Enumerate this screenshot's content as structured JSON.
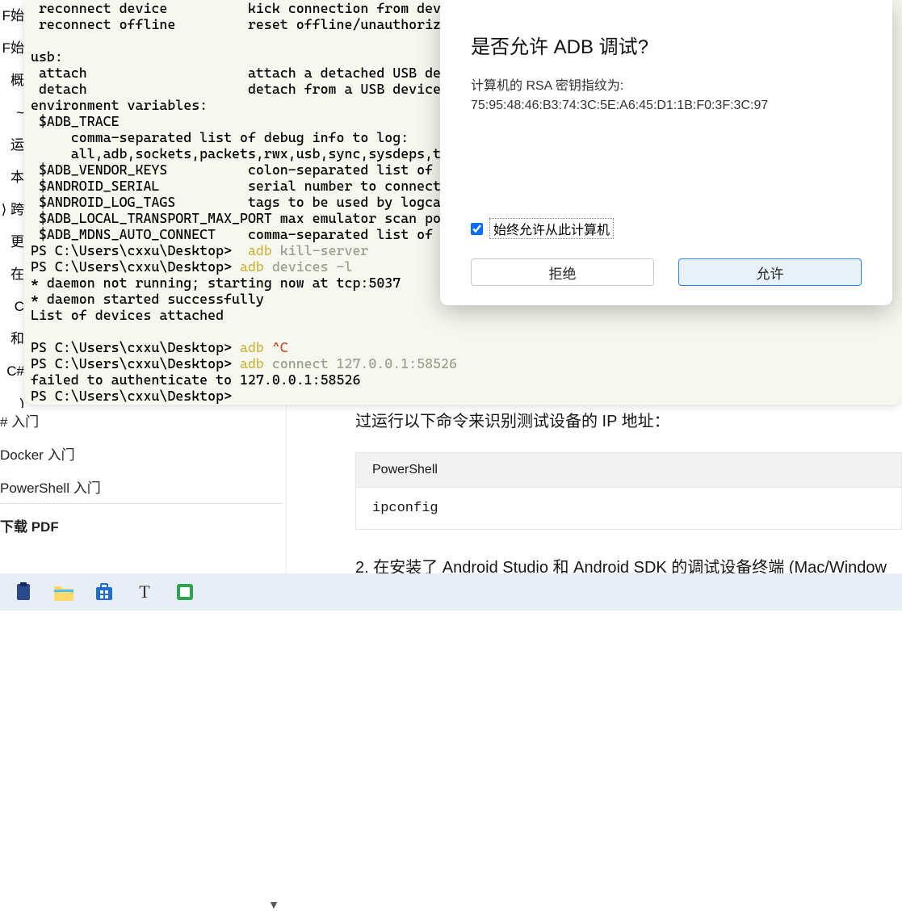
{
  "terminal": {
    "lines_pre": " reconnect device          kick connection from dev\n reconnect offline         reset offline/unauthoriz\n\nusb:\n attach                    attach a detached USB de\n detach                    detach from a USB device\nenvironment variables:\n $ADB_TRACE\n     comma-separated list of debug info to log:\n     all,adb,sockets,packets,rwx,usb,sync,sysdeps,t\n $ADB_VENDOR_KEYS          colon-separated list of k\n $ANDROID_SERIAL           serial number to connect \n $ANDROID_LOG_TAGS         tags to be used by logcat\n $ADB_LOCAL_TRANSPORT_MAX_PORT max emulator scan po\n $ADB_MDNS_AUTO_CONNECT    comma-separated list of m",
    "prompt1": "PS C:\\Users\\cxxu\\Desktop>  ",
    "cmd1a": "adb",
    "cmd1b": " kill-server",
    "prompt2": "PS C:\\Users\\cxxu\\Desktop> ",
    "cmd2a": "adb",
    "cmd2b": " devices -l",
    "daemon1": "* daemon not running; starting now at tcp:5037",
    "daemon2": "* daemon started successfully",
    "listhdr": "List of devices attached",
    "prompt3": "PS C:\\Users\\cxxu\\Desktop> ",
    "cmd3a": "adb",
    "cmd3b": " ^C",
    "prompt4": "PS C:\\Users\\cxxu\\Desktop> ",
    "cmd4a": "adb",
    "cmd4b": " connect 127.0.0.1:58526",
    "fail": "failed to authenticate to 127.0.0.1:58526",
    "prompt5": "PS C:\\Users\\cxxu\\Desktop> "
  },
  "sidecut": [
    "F始",
    "F始",
    "概",
    "~ 运",
    "",
    "",
    "",
    "",
    "",
    "本",
    "⟩ 跨",
    "更",
    "在",
    "C 和",
    "C# )"
  ],
  "sidebar": {
    "items": [
      "# 入门",
      "Docker 入门",
      "PowerShell 入门"
    ],
    "pdf": "下载 PDF",
    "dropdown_glyph": "▼"
  },
  "article": {
    "line1": "过运行以下命令来识别测试设备的 IP 地址：",
    "codehead": "PowerShell",
    "codebody": "ipconfig",
    "step2_num": "2.",
    "step2_txt": " 在安装了 Android Studio 和 Android SDK 的调试设备终端 (Mac/Window"
  },
  "dialog": {
    "title": "是否允许 ADB 调试?",
    "rsa_label": "计算机的 RSA 密钥指纹为:",
    "rsa_value": "75:95:48:46:B3:74:3C:5E:A6:45:D1:1B:F0:3F:3C:97",
    "checkbox_label": "始终允许从此计算机",
    "deny": "拒绝",
    "allow": "允许"
  },
  "taskbar": {
    "icons": [
      "clipboard",
      "folder",
      "store",
      "text",
      "subsystem"
    ]
  }
}
